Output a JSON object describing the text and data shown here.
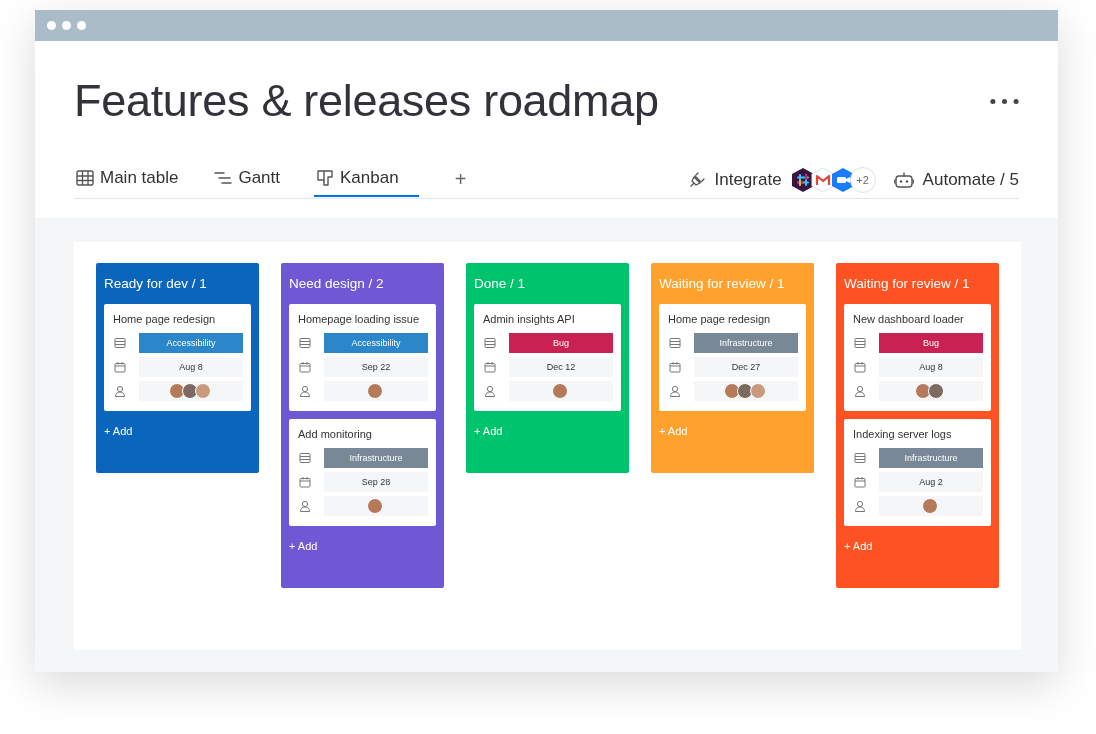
{
  "window": {
    "title": "Features & releases roadmap"
  },
  "tabs": [
    {
      "label": "Main table",
      "kind": "table",
      "selected": false
    },
    {
      "label": "Gantt",
      "kind": "gantt",
      "selected": false
    },
    {
      "label": "Kanban",
      "kind": "kanban",
      "selected": true
    }
  ],
  "add_tab": "+",
  "integrate": {
    "label": "Integrate",
    "apps": [
      {
        "kind": "slack"
      },
      {
        "kind": "gmail"
      },
      {
        "kind": "zoom"
      }
    ],
    "more": "+2"
  },
  "automate": {
    "label": "Automate / 5"
  },
  "columns": [
    {
      "title": "Ready for dev / 1",
      "color": "#0a66bd",
      "add": "+ Add",
      "cards": [
        {
          "title": "Home page redesign",
          "tag": {
            "label": "Accessibility",
            "color": "#2b87c9"
          },
          "date": "Aug 8",
          "avatars": [
            {
              "kind": "photo"
            },
            {
              "kind": "photo"
            },
            {
              "kind": "photo"
            }
          ]
        }
      ]
    },
    {
      "title": "Need design / 2",
      "color": "#6e58d4",
      "add": "+ Add",
      "cards": [
        {
          "title": "Homepage loading issue",
          "tag": {
            "label": "Accessibility",
            "color": "#2b87c9"
          },
          "date": "Sep 22",
          "avatars": [
            {
              "kind": "photo"
            }
          ]
        },
        {
          "title": "Add monitoring",
          "tag": {
            "label": "Infrastructure",
            "color": "#788896"
          },
          "date": "Sep 28",
          "avatars": [
            {
              "kind": "photo"
            }
          ]
        }
      ]
    },
    {
      "title": "Done / 1",
      "color": "#00c46d",
      "add": "+ Add",
      "cards": [
        {
          "title": "Admin insights API",
          "tag": {
            "label": "Bug",
            "color": "#c92252"
          },
          "date": "Dec 12",
          "avatars": [
            {
              "kind": "photo"
            }
          ]
        }
      ]
    },
    {
      "title": "Waiting for review / 1",
      "color": "#ffa12d",
      "add": "+ Add",
      "cards": [
        {
          "title": "Home page redesign",
          "tag": {
            "label": "Infrastructure",
            "color": "#788896"
          },
          "date": "Dec 27",
          "avatars": [
            {
              "kind": "photo"
            },
            {
              "kind": "photo"
            },
            {
              "kind": "photo"
            }
          ]
        }
      ]
    },
    {
      "title": "Waiting for review / 1",
      "color": "#ff5222",
      "add": "+ Add",
      "cards": [
        {
          "title": "New dashboard loader",
          "tag": {
            "label": "Bug",
            "color": "#c92252"
          },
          "date": "Aug 8",
          "avatars": [
            {
              "kind": "photo"
            },
            {
              "kind": "photo"
            }
          ]
        },
        {
          "title": "Indexing server logs",
          "tag": {
            "label": "Infrastructure",
            "color": "#788896"
          },
          "date": "Aug 2",
          "avatars": [
            {
              "kind": "photo"
            }
          ]
        }
      ]
    }
  ]
}
